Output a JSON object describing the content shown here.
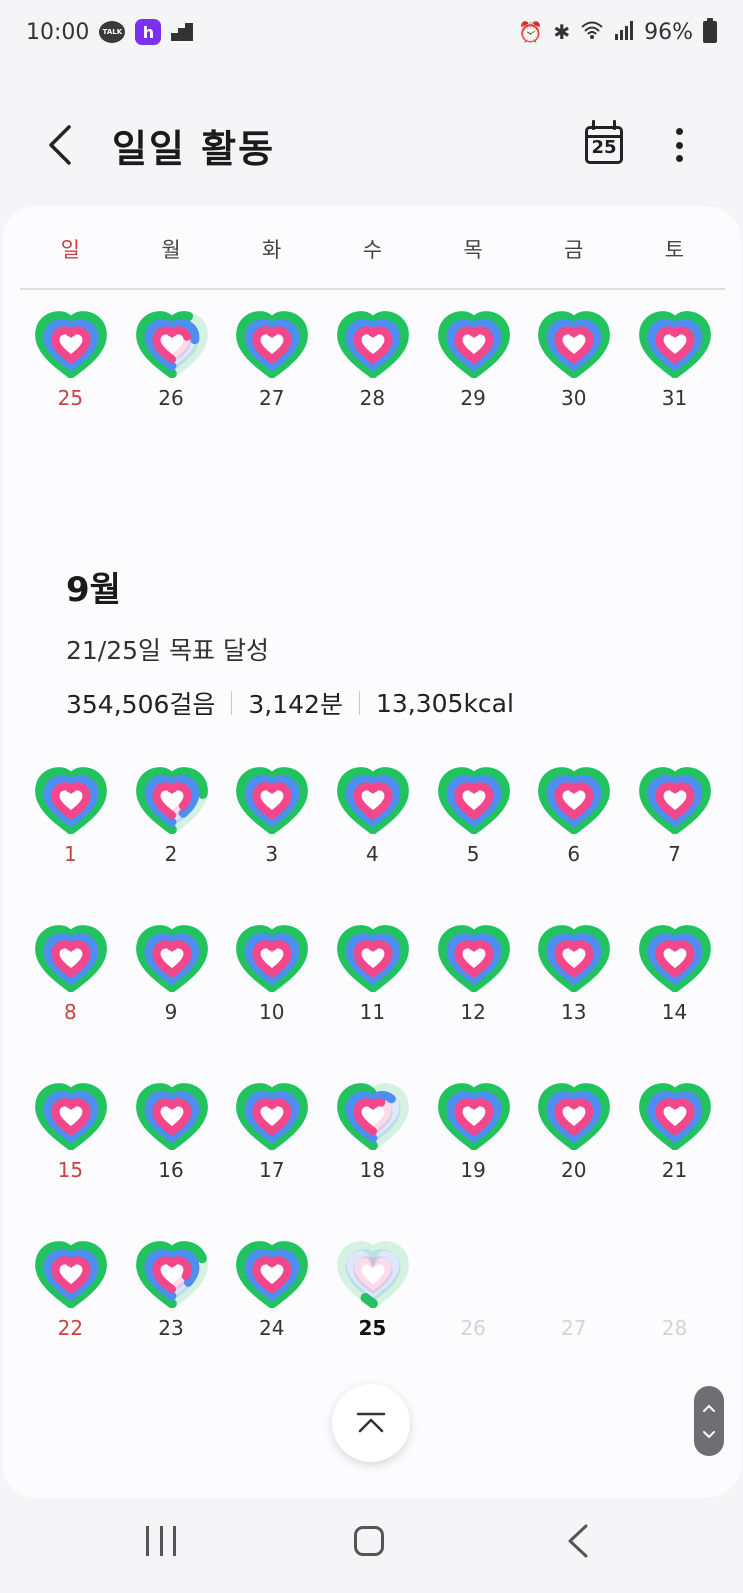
{
  "status_bar": {
    "time": "10:00",
    "talk_label": "TALK",
    "h_label": "h",
    "battery": "96%"
  },
  "header": {
    "title": "일일 활동",
    "calendar_day": "25"
  },
  "weekdays": [
    "일",
    "월",
    "화",
    "수",
    "목",
    "금",
    "토"
  ],
  "previous_week": [
    {
      "day": "25",
      "progress": 1.0,
      "state": "full"
    },
    {
      "day": "26",
      "progress": 0.6,
      "state": "partial"
    },
    {
      "day": "27",
      "progress": 1.0,
      "state": "full"
    },
    {
      "day": "28",
      "progress": 1.0,
      "state": "full"
    },
    {
      "day": "29",
      "progress": 1.0,
      "state": "full"
    },
    {
      "day": "30",
      "progress": 1.0,
      "state": "full"
    },
    {
      "day": "31",
      "progress": 1.0,
      "state": "full"
    }
  ],
  "month_summary": {
    "month": "9월",
    "goal_text": "21/25일 목표 달성",
    "steps": "354,506걸음",
    "minutes": "3,142분",
    "calories": "13,305kcal"
  },
  "month_weeks": [
    [
      {
        "day": "1",
        "progress": 1.0,
        "state": "full"
      },
      {
        "day": "2",
        "progress": 0.75,
        "state": "partial"
      },
      {
        "day": "3",
        "progress": 1.0,
        "state": "full"
      },
      {
        "day": "4",
        "progress": 1.0,
        "state": "full"
      },
      {
        "day": "5",
        "progress": 1.0,
        "state": "full"
      },
      {
        "day": "6",
        "progress": 1.0,
        "state": "full"
      },
      {
        "day": "7",
        "progress": 1.0,
        "state": "full"
      }
    ],
    [
      {
        "day": "8",
        "progress": 1.0,
        "state": "full"
      },
      {
        "day": "9",
        "progress": 1.0,
        "state": "full"
      },
      {
        "day": "10",
        "progress": 1.0,
        "state": "full"
      },
      {
        "day": "11",
        "progress": 1.0,
        "state": "full"
      },
      {
        "day": "12",
        "progress": 1.0,
        "state": "full"
      },
      {
        "day": "13",
        "progress": 1.0,
        "state": "full"
      },
      {
        "day": "14",
        "progress": 1.0,
        "state": "full"
      }
    ],
    [
      {
        "day": "15",
        "progress": 1.0,
        "state": "full"
      },
      {
        "day": "16",
        "progress": 1.0,
        "state": "full"
      },
      {
        "day": "17",
        "progress": 1.0,
        "state": "full"
      },
      {
        "day": "18",
        "progress": 0.5,
        "state": "partial"
      },
      {
        "day": "19",
        "progress": 1.0,
        "state": "full"
      },
      {
        "day": "20",
        "progress": 1.0,
        "state": "full"
      },
      {
        "day": "21",
        "progress": 1.0,
        "state": "full"
      }
    ],
    [
      {
        "day": "22",
        "progress": 1.0,
        "state": "full"
      },
      {
        "day": "23",
        "progress": 0.7,
        "state": "partial"
      },
      {
        "day": "24",
        "progress": 1.0,
        "state": "full"
      },
      {
        "day": "25",
        "progress": 0.05,
        "state": "today"
      },
      {
        "day": "26",
        "progress": 0,
        "state": "future"
      },
      {
        "day": "27",
        "progress": 0,
        "state": "future"
      },
      {
        "day": "28",
        "progress": 0,
        "state": "future"
      }
    ]
  ],
  "colors": {
    "sunday": "#c9433c",
    "ring_outer": "#22c35e",
    "ring_middle": "#4d8ef0",
    "ring_inner": "#f2478a"
  }
}
